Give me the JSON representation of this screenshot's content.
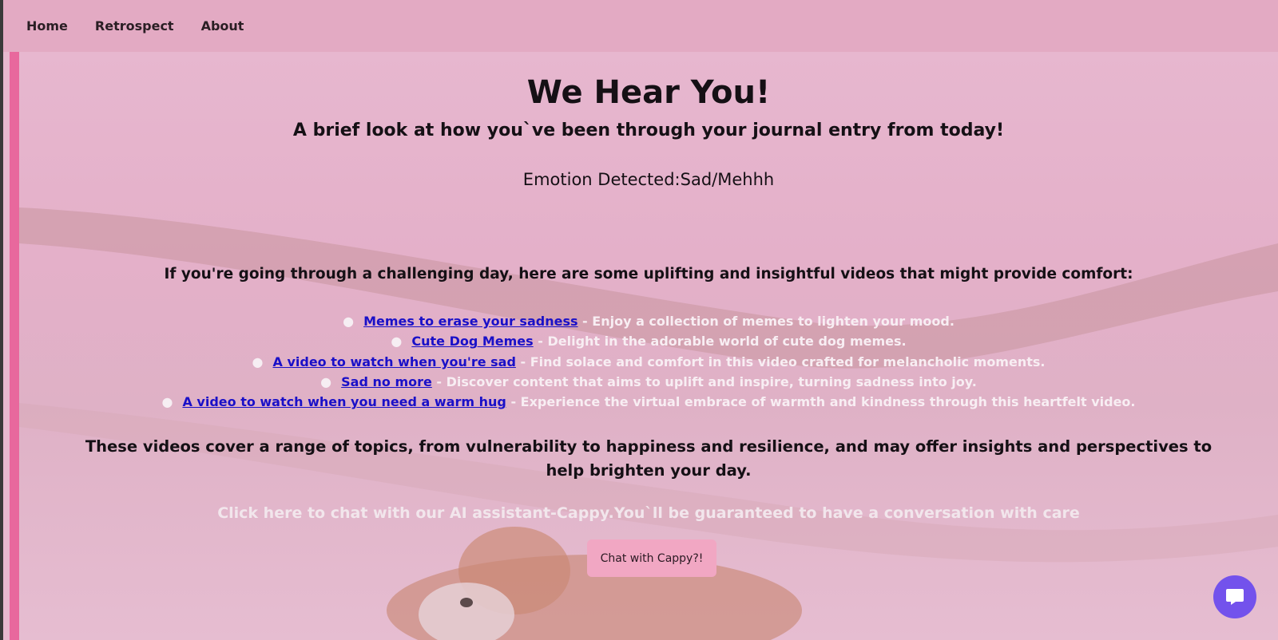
{
  "nav": {
    "items": [
      {
        "label": "Home"
      },
      {
        "label": "Retrospect"
      },
      {
        "label": "About"
      }
    ]
  },
  "main": {
    "title": "We Hear You!",
    "subtitle": "A brief look at how you`ve been through your journal entry from today!",
    "emotion": "Emotion Detected:Sad/Mehhh",
    "intro": "If you're going through a challenging day, here are some uplifting and insightful videos that might provide comfort:",
    "videos": [
      {
        "link": "Memes to erase your sadness",
        "desc": " - Enjoy a collection of memes to lighten your mood."
      },
      {
        "link": "Cute Dog Memes",
        "desc": " - Delight in the adorable world of cute dog memes."
      },
      {
        "link": "A video to watch when you're sad",
        "desc": " - Find solace and comfort in this video crafted for melancholic moments."
      },
      {
        "link": "Sad no more",
        "desc": " - Discover content that aims to uplift and inspire, turning sadness into joy."
      },
      {
        "link": "A video to watch when you need a warm hug",
        "desc": " - Experience the virtual embrace of warmth and kindness through this heartfelt video."
      }
    ],
    "outro": "These videos cover a range of topics, from vulnerability to happiness and resilience, and may offer insights and perspectives to help brighten your day.",
    "cta": "Click here to chat with our AI assistant-Cappy.You`ll be guaranteed to have a conversation with care",
    "chat_button": "Chat with Cappy?!"
  },
  "colors": {
    "navbar": "#e3aac3",
    "accent_border": "#e8689d",
    "link": "#1a10c8",
    "button": "#f1a7c3",
    "chat_widget": "#7352ec"
  },
  "icons": {
    "chat_widget": "chat-bubble-icon",
    "background": "corgi-in-snow-photo"
  }
}
